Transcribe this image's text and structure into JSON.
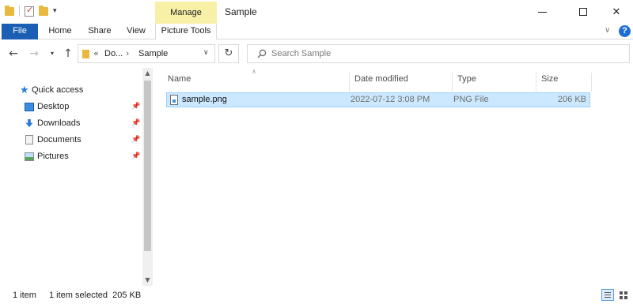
{
  "window": {
    "title": "Sample",
    "contextual_tab": "Manage"
  },
  "ribbon": {
    "tabs": [
      "File",
      "Home",
      "Share",
      "View",
      "Picture Tools"
    ],
    "accent_color": "#1a5fb4",
    "contextual_color": "#f7f0a6"
  },
  "address": {
    "breadcrumb_short": "Do...",
    "current_folder": "Sample"
  },
  "search": {
    "placeholder": "Search Sample"
  },
  "sidebar": {
    "quick_access_label": "Quick access",
    "items": [
      {
        "label": "Desktop",
        "icon": "desktop-icon",
        "pinned": true
      },
      {
        "label": "Downloads",
        "icon": "downloads-icon",
        "pinned": true
      },
      {
        "label": "Documents",
        "icon": "documents-icon",
        "pinned": true
      },
      {
        "label": "Pictures",
        "icon": "pictures-icon",
        "pinned": true
      }
    ]
  },
  "file_list": {
    "columns": [
      "Name",
      "Date modified",
      "Type",
      "Size"
    ],
    "rows": [
      {
        "name": "sample.png",
        "date_modified": "2022-07-12 3:08 PM",
        "type": "PNG File",
        "size": "206 KB",
        "selected": true
      }
    ]
  },
  "status": {
    "item_count": "1 item",
    "selection": "1 item selected  205 KB"
  }
}
